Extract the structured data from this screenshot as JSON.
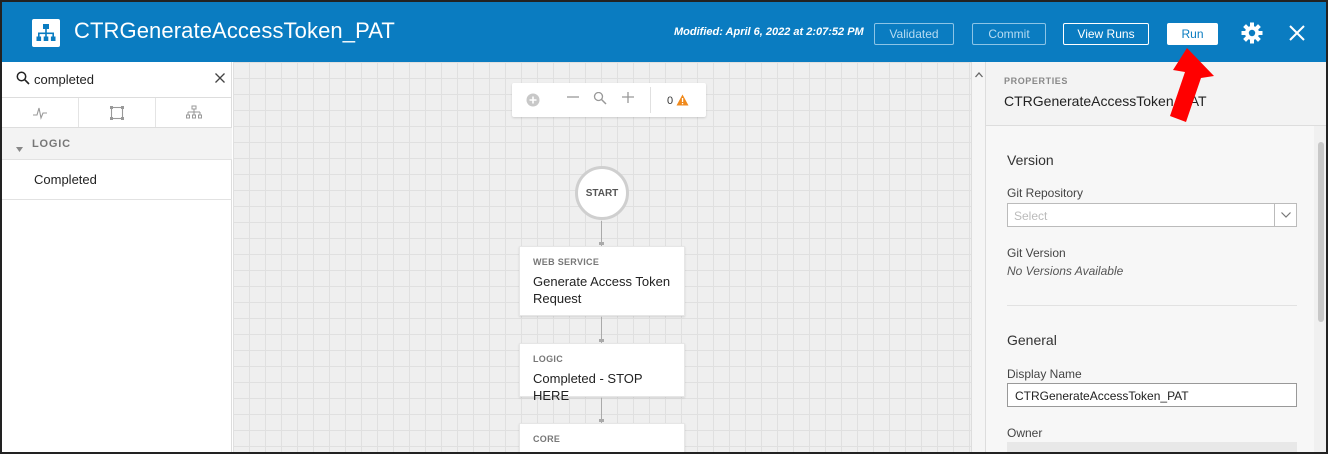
{
  "header": {
    "title": "CTRGenerateAccessToken_PAT",
    "modified": "Modified: April 6, 2022 at 2:07:52 PM",
    "buttons": {
      "validated": "Validated",
      "commit": "Commit",
      "view_runs": "View Runs",
      "run": "Run"
    },
    "icons": [
      "workflow-icon",
      "gear-icon",
      "close-icon"
    ],
    "brand_color": "#0a7cc1"
  },
  "sidebar": {
    "search": {
      "value": "completed",
      "placeholder": ""
    },
    "tabs": [
      "activity-icon",
      "container-icon",
      "hierarchy-icon"
    ],
    "section": "LOGIC",
    "items": [
      {
        "label": "Completed"
      }
    ]
  },
  "canvas": {
    "warning_count": "0",
    "start_label": "START",
    "nodes": [
      {
        "type": "WEB SERVICE",
        "name": "Generate Access Token Request"
      },
      {
        "type": "LOGIC",
        "name": "Completed - STOP HERE"
      },
      {
        "type": "CORE",
        "name": ""
      }
    ]
  },
  "properties": {
    "caption": "PROPERTIES",
    "title": "CTRGenerateAccessToken_PAT",
    "version_section": "Version",
    "git_repository_label": "Git Repository",
    "git_repository_placeholder": "Select",
    "git_version_label": "Git Version",
    "git_version_value": "No Versions Available",
    "general_section": "General",
    "display_name_label": "Display Name",
    "display_name_value": "CTRGenerateAccessToken_PAT",
    "owner_label": "Owner"
  },
  "annotation": {
    "color": "#ff0000"
  }
}
